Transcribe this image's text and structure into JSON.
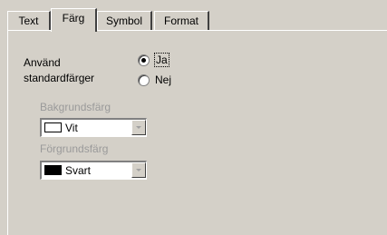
{
  "tabs": [
    {
      "label": "Text",
      "active": false
    },
    {
      "label": "Färg",
      "active": true
    },
    {
      "label": "Symbol",
      "active": false
    },
    {
      "label": "Format",
      "active": false
    }
  ],
  "use_defaults": {
    "label": "Använd\nstandardfärger",
    "options": [
      {
        "label": "Ja",
        "selected": true
      },
      {
        "label": "Nej",
        "selected": false
      }
    ]
  },
  "background": {
    "label": "Bakgrundsfärg",
    "value": "Vit",
    "swatch_color": "#ffffff"
  },
  "foreground": {
    "label": "Förgrundsfärg",
    "value": "Svart",
    "swatch_color": "#000000"
  },
  "icons": {
    "dropdown": "chevron-down-icon"
  }
}
